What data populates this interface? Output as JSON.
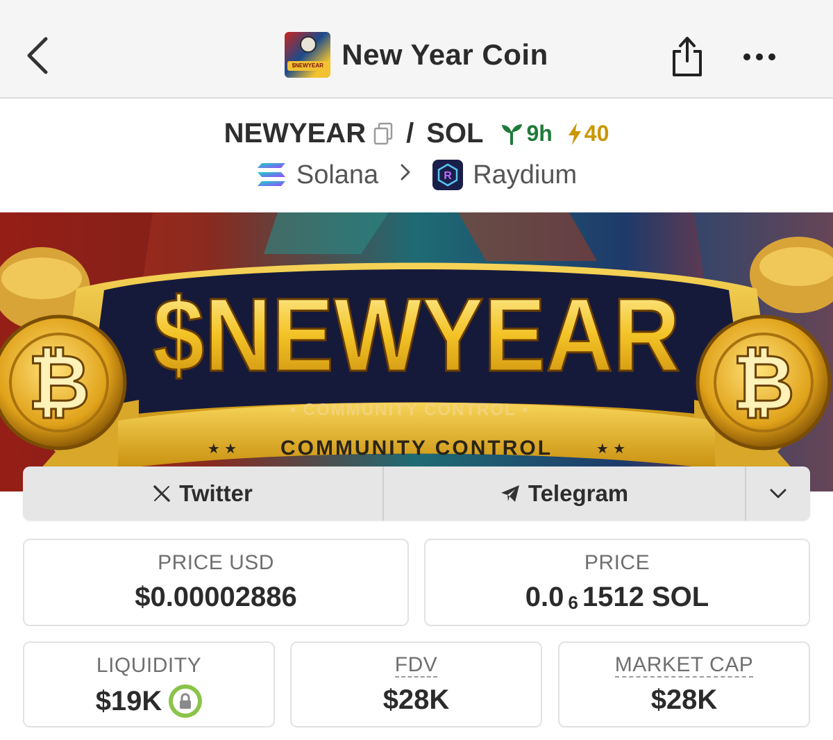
{
  "header": {
    "title": "New Year Coin",
    "logo_text": "$NEWYEAR",
    "back_icon": "chevron-left-icon",
    "share_icon": "share-icon",
    "more_icon": "ellipsis-icon"
  },
  "pair": {
    "base": "NEWYEAR",
    "separator": "/",
    "quote": "SOL",
    "age": "9h",
    "boost": "40",
    "age_color": "#1f7a3a",
    "boost_color": "#c99700"
  },
  "chain": {
    "network": "Solana",
    "dex": "Raydium"
  },
  "banner": {
    "headline": "$NEWYEAR",
    "tagline_1": "• COMMUNITY CONTROL •",
    "tagline_2": "COMMUNITY CONTROL"
  },
  "socials": {
    "twitter": "Twitter",
    "telegram": "Telegram"
  },
  "stats": {
    "price_usd_label": "PRICE USD",
    "price_usd": "$0.00002886",
    "price_label": "PRICE",
    "price_prefix": "0.0",
    "price_zeros": "6",
    "price_digits": "1512 SOL",
    "liquidity_label": "LIQUIDITY",
    "liquidity": "$19K",
    "fdv_label": "FDV",
    "fdv": "$28K",
    "mcap_label": "MARKET CAP",
    "mcap": "$28K"
  },
  "colors": {
    "accent_gold": "#f1c232",
    "lock_green": "#8bc34a"
  }
}
